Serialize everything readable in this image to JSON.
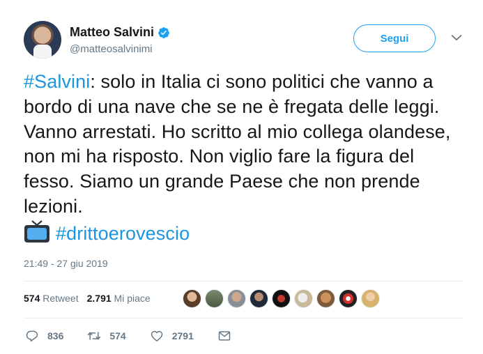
{
  "tweet": {
    "author": {
      "display_name": "Matteo Salvini",
      "handle": "@matteosalvinimi",
      "verified": true
    },
    "follow_label": "Segui",
    "text": {
      "hashtag_1": "#Salvini",
      "body": ": solo in Italia ci sono politici che vanno a bordo di una nave che se ne è fregata delle leggi. Vanno arrestati. Ho scritto al mio collega olandese, non mi ha risposto. Non viglio fare la figura del fesso. Siamo un grande Paese che non prende lezioni.",
      "emoji_icon": "tv-icon",
      "hashtag_2": "#drittoerovescio"
    },
    "timestamp": "21:49 - 27 giu 2019",
    "stats": {
      "retweets_count": "574",
      "retweets_label": "Retweet",
      "likes_count": "2.791",
      "likes_label": "Mi piace"
    },
    "likers": [
      "liker-avatar-1",
      "liker-avatar-2",
      "liker-avatar-3",
      "liker-avatar-4",
      "liker-avatar-5",
      "liker-avatar-6",
      "liker-avatar-7",
      "liker-avatar-8",
      "liker-avatar-9"
    ],
    "actions": {
      "reply_count": "836",
      "retweet_count": "574",
      "like_count": "2791"
    },
    "colors": {
      "accent": "#1da1f2",
      "hashtag": "#1b95e0",
      "muted": "#657786"
    }
  }
}
